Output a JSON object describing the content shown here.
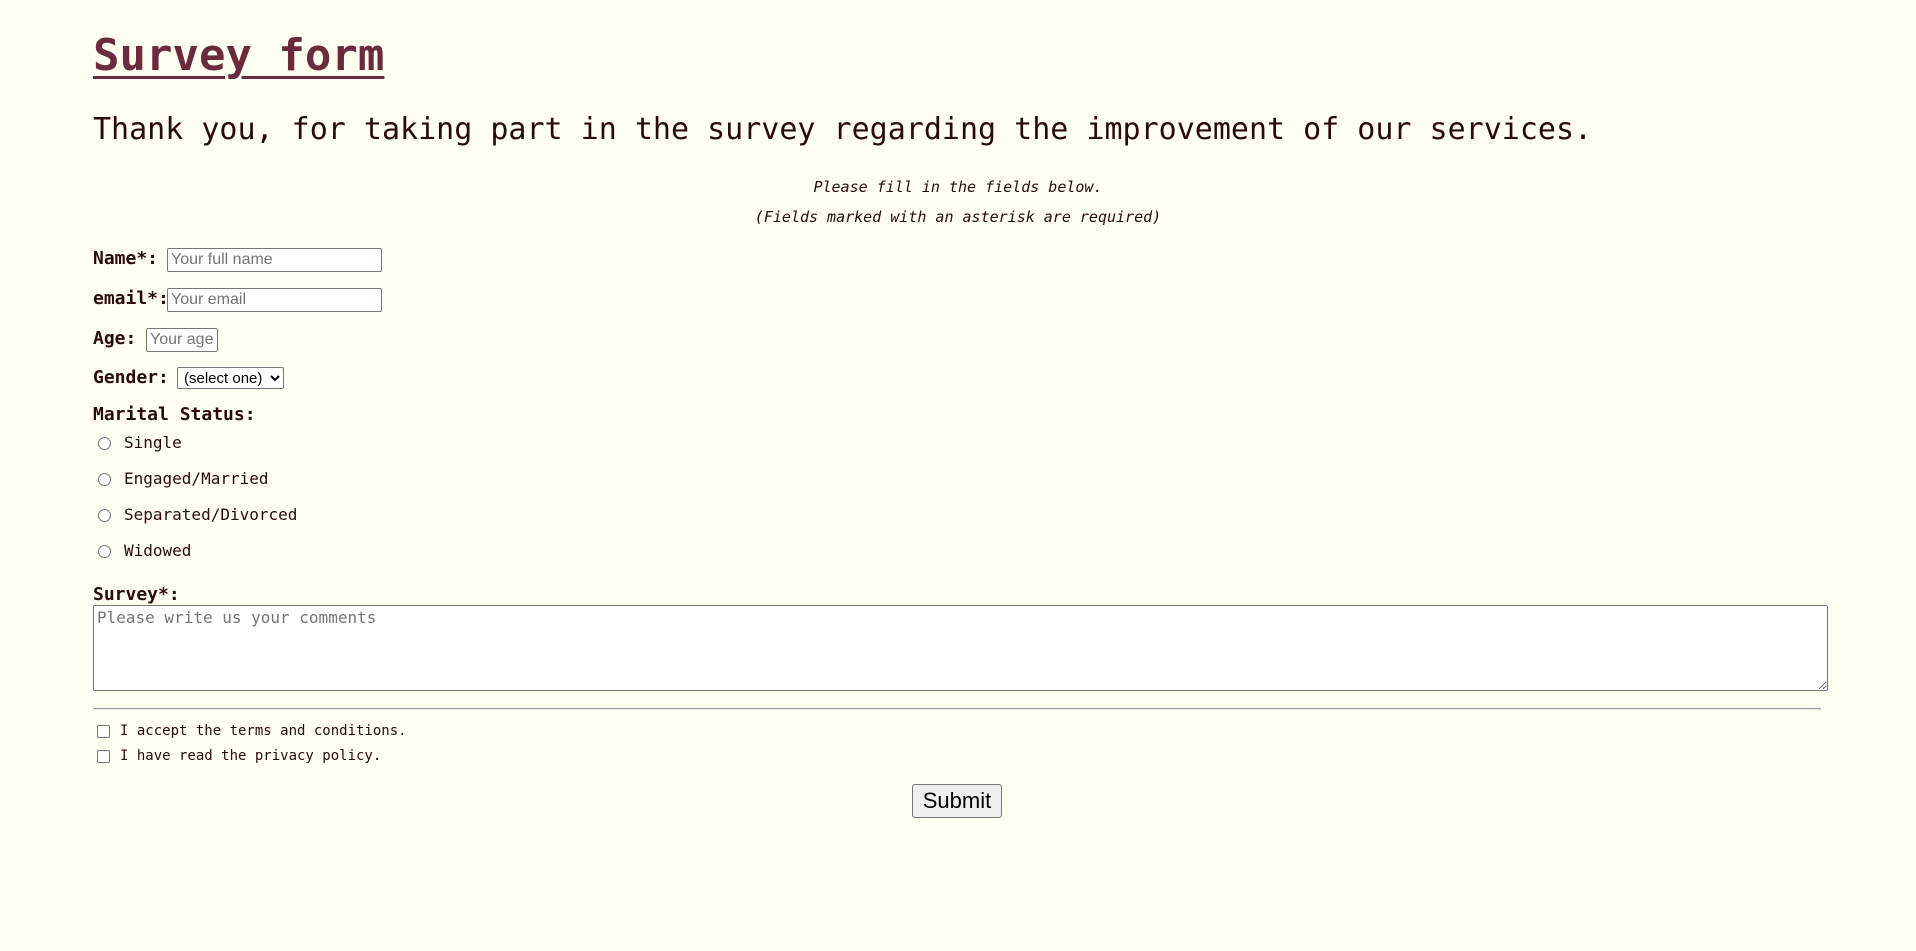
{
  "header": {
    "title": "Survey form",
    "subtitle": "Thank you, for taking part in the survey regarding the improvement of our services.",
    "instruction": "Please fill in the fields below.",
    "required_note": "(Fields marked with an asterisk are required)"
  },
  "form": {
    "name": {
      "label": "Name*:",
      "placeholder": "Your full name",
      "value": ""
    },
    "email": {
      "label": "email*:",
      "placeholder": "Your email",
      "value": ""
    },
    "age": {
      "label": "Age:",
      "placeholder": "Your age",
      "value": ""
    },
    "gender": {
      "label": "Gender:",
      "selected": "(select one)"
    },
    "marital_status": {
      "label": "Marital Status:",
      "options": [
        "Single",
        "Engaged/Married",
        "Separated/Divorced",
        "Widowed"
      ]
    },
    "survey": {
      "label": "Survey*:",
      "placeholder": "Please write us your comments",
      "value": ""
    },
    "terms_label": "I accept the terms and conditions.",
    "privacy_label": "I have read the privacy policy.",
    "submit_label": "Submit"
  },
  "colors": {
    "background": "#fdfff0",
    "title": "#6b2a3e",
    "text": "#2a0a0a"
  },
  "icons": {
    "select_arrow": "chevron-down-icon"
  }
}
